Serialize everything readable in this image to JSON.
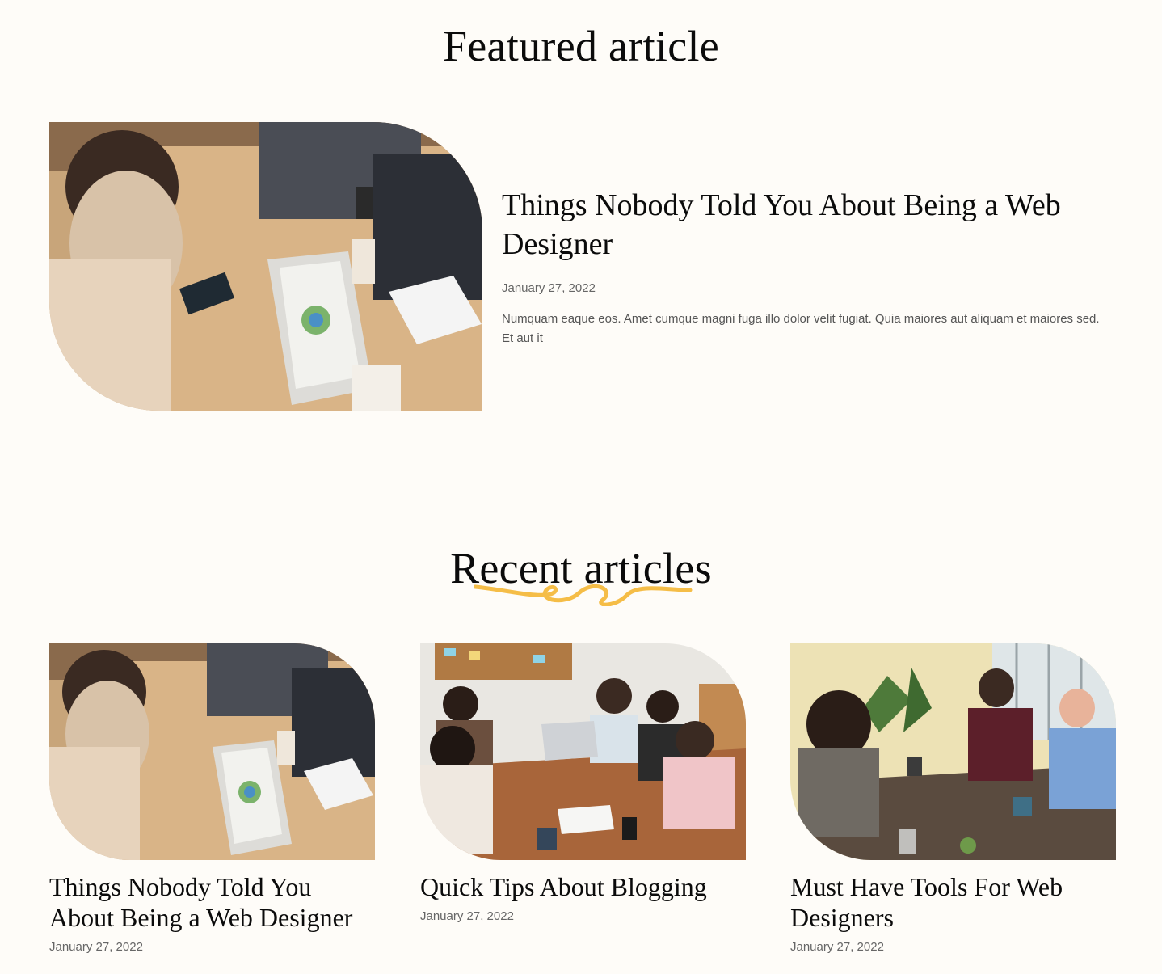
{
  "featured_section": {
    "title": "Featured article",
    "article": {
      "headline": "Things Nobody Told You About Being a Web Designer",
      "date": "January 27, 2022",
      "excerpt": "Numquam eaque eos. Amet cumque magni fuga illo dolor velit fugiat. Quia maiores aut aliquam et maiores sed. Et aut it"
    }
  },
  "recent_section": {
    "title": "Recent articles",
    "accent_color": "#f5bd47",
    "articles": [
      {
        "title": "Things Nobody Told You About Being a Web Designer",
        "date": "January 27, 2022"
      },
      {
        "title": "Quick Tips About Blogging",
        "date": "January 27, 2022"
      },
      {
        "title": "Must Have Tools For Web Designers",
        "date": "January 27, 2022"
      }
    ]
  },
  "colors": {
    "background": "#fefcf8",
    "heading": "#0b0b0b",
    "meta_text": "#666666",
    "accent": "#f5bd47"
  }
}
